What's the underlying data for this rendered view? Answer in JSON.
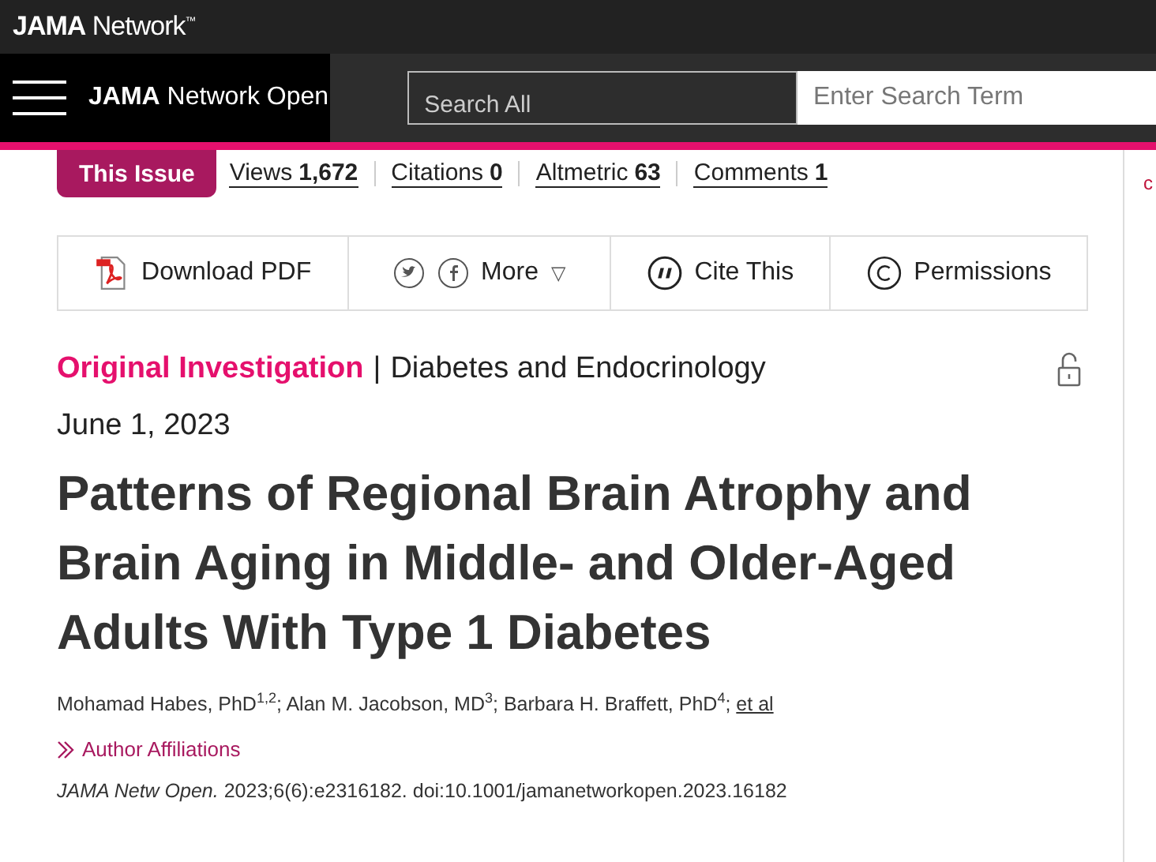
{
  "top_bar": {
    "brand": "**JAMA** Network$^{™}$"
  },
  "nav": {
    "journal": "**JAMA** Network Open",
    "search_scope": "Search All",
    "search": {
      "placeholder": "Enter Search Term"
    }
  },
  "issue_tab": {
    "label": "This Issue",
    "selected": true
  },
  "metrics": [
    {
      "label": "Views",
      "value": "1,672"
    },
    {
      "label": "Citations",
      "value": "0"
    },
    {
      "label": "Altmetric",
      "value": "63"
    },
    {
      "label": "Comments",
      "value": "1"
    }
  ],
  "toolbar": [
    {
      "kind": "pdf",
      "label": "Download PDF"
    },
    {
      "kind": "share",
      "label": "More",
      "caret": "▽"
    },
    {
      "kind": "cite",
      "label": "Cite This"
    },
    {
      "kind": "permissions",
      "label": "Permissions"
    }
  ],
  "article": {
    "category": "Original Investigation",
    "separator": "|",
    "subject": "Diabetes and Endocrinology",
    "open_access": true,
    "date": "June 1, 2023",
    "title": "Patterns of Regional Brain Atrophy and Brain Aging in Middle- and Older-Aged Adults With Type 1 Diabetes",
    "authors": "Mohamad Habes, PhD$^{1,2}$; Alan M. Jacobson, MD$^{3}$; Barbara H. Braffett, PhD$^{4}$; ",
    "authors_link": "et al",
    "affiliations": "Author Affiliations",
    "citation": "*JAMA Netw Open.* 2023;6(6):e2316182. doi:10.1001/jamanetworkopen.2023.16182"
  },
  "side_panel": {
    "text": "c"
  }
}
